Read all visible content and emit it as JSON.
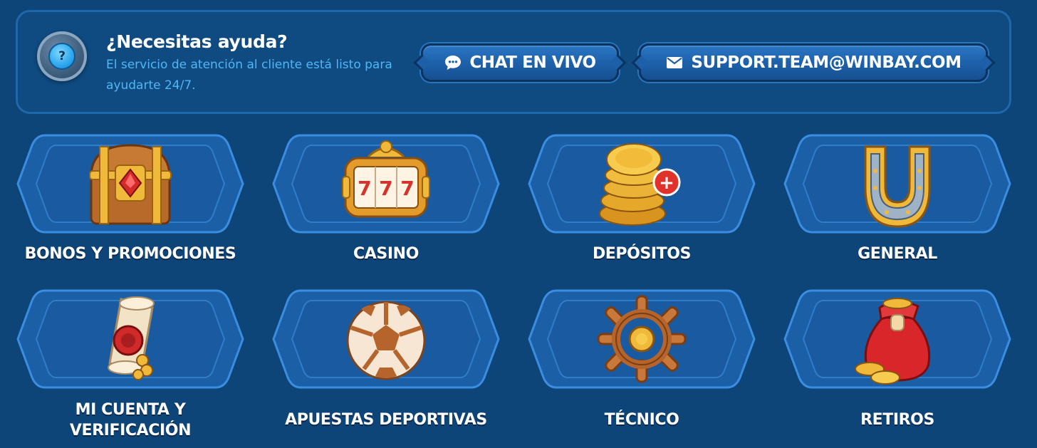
{
  "help": {
    "icon": "question-icon",
    "icon_glyph": "?",
    "title": "¿Necesitas ayuda?",
    "description": "El servicio de atención al cliente está listo para ayudarte 24/7.",
    "chat_button": {
      "label": "CHAT EN VIVO",
      "icon": "chat-bubble-icon"
    },
    "email_button": {
      "label": "SUPPORT.TEAM@WINBAY.COM",
      "icon": "envelope-icon"
    }
  },
  "categories": [
    {
      "label": "BONOS Y PROMOCIONES",
      "icon": "treasure-chest-icon"
    },
    {
      "label": "CASINO",
      "icon": "slot-machine-icon",
      "reels": "777"
    },
    {
      "label": "DEPÓSITOS",
      "icon": "coin-stack-plus-icon",
      "badge": "+"
    },
    {
      "label": "GENERAL",
      "icon": "horseshoe-icon"
    },
    {
      "label": "MI CUENTA Y VERIFICACIÓN",
      "icon": "sealed-scroll-icon"
    },
    {
      "label": "APUESTAS DEPORTIVAS",
      "icon": "soccer-ball-icon"
    },
    {
      "label": "TÉCNICO",
      "icon": "ship-wheel-icon"
    },
    {
      "label": "RETIROS",
      "icon": "money-bag-icon"
    }
  ],
  "colors": {
    "background": "#0e4579",
    "panel": "#0f4a80",
    "panel_border": "#1f67aa",
    "accent_text": "#4fb7f6",
    "button": "#1d5fa8",
    "card": "#1a5ea6",
    "card_border": "#3c8fe0"
  }
}
